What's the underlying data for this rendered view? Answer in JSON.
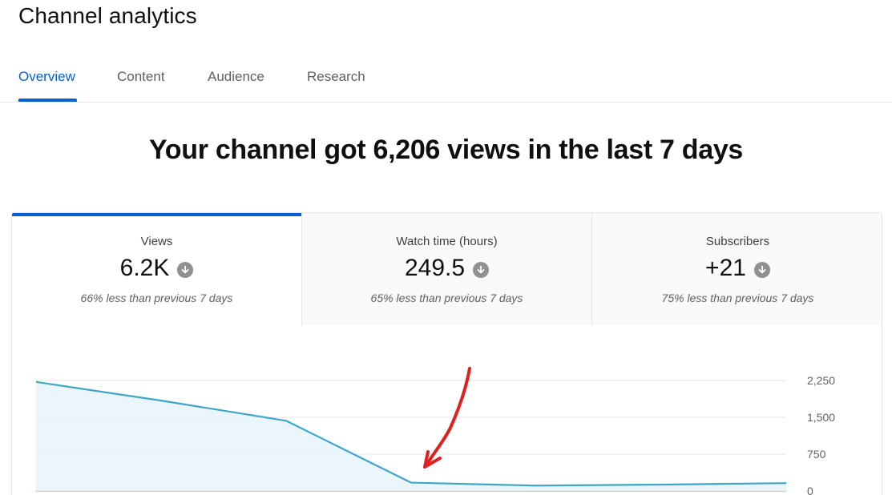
{
  "page": {
    "title": "Channel analytics"
  },
  "tabs": [
    {
      "label": "Overview",
      "active": true
    },
    {
      "label": "Content",
      "active": false
    },
    {
      "label": "Audience",
      "active": false
    },
    {
      "label": "Research",
      "active": false
    }
  ],
  "headline": "Your channel got 6,206 views in the last 7 days",
  "metrics": [
    {
      "label": "Views",
      "value": "6.2K",
      "compare": "66% less than previous 7 days",
      "trend_icon": "arrow-down-circle-icon",
      "selected": true
    },
    {
      "label": "Watch time (hours)",
      "value": "249.5",
      "compare": "65% less than previous 7 days",
      "trend_icon": "arrow-down-circle-icon",
      "selected": false
    },
    {
      "label": "Subscribers",
      "value": "+21",
      "compare": "75% less than previous 7 days",
      "trend_icon": "arrow-down-circle-icon",
      "selected": false
    }
  ],
  "colors": {
    "accent": "#065fd4",
    "line": "#3ea6c6",
    "area": "#e6f4fa",
    "annotation": "#e0201e"
  },
  "chart_data": {
    "type": "area",
    "x": [
      1,
      2,
      3,
      4,
      5,
      6,
      7
    ],
    "series": [
      {
        "values": [
          2220,
          1840,
          1430,
          170,
          110,
          130,
          160
        ]
      }
    ],
    "y_ticks": [
      "2,250",
      "1,500",
      "750",
      "0"
    ],
    "y_tick_values": [
      2250,
      1500,
      750,
      0
    ],
    "ylim": [
      0,
      2250
    ],
    "grid": true,
    "annotation": "red-hand-drawn-arrow"
  }
}
